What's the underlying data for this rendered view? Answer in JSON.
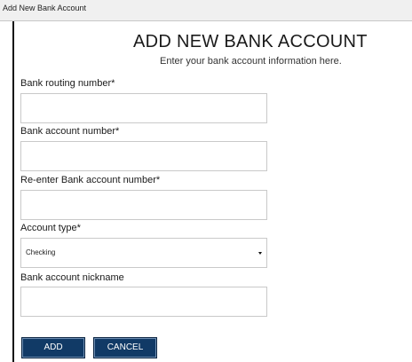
{
  "window": {
    "title": "Add New Bank Account"
  },
  "page": {
    "heading": "ADD NEW BANK ACCOUNT",
    "subheading": "Enter your bank account information here."
  },
  "form": {
    "routing_number": {
      "label": "Bank routing number*",
      "value": ""
    },
    "account_number": {
      "label": "Bank account number*",
      "value": ""
    },
    "confirm_account_number": {
      "label": "Re-enter Bank account number*",
      "value": ""
    },
    "account_type": {
      "label": "Account type*",
      "selected": "Checking"
    },
    "nickname": {
      "label": "Bank account nickname",
      "value": ""
    }
  },
  "actions": {
    "add_label": "ADD",
    "cancel_label": "CANCEL"
  },
  "colors": {
    "button_background": "#113a66",
    "button_text": "#ffffff",
    "input_border": "#c9c9c9"
  },
  "icons": {
    "select_caret": "caret-down-icon"
  }
}
